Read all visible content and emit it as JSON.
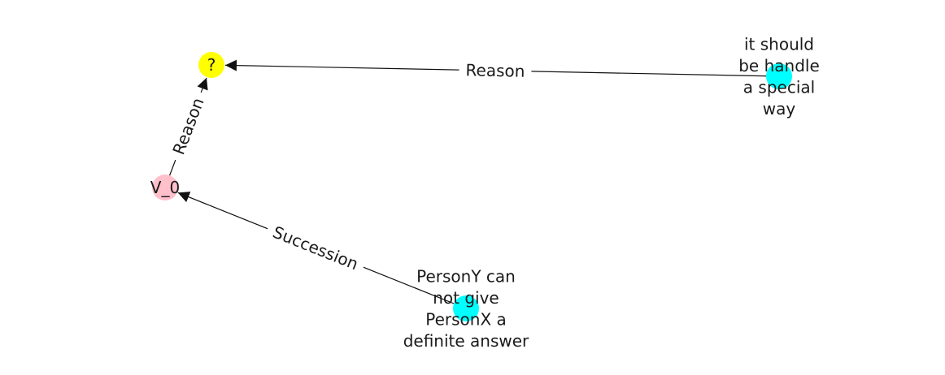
{
  "graph": {
    "nodes": [
      {
        "id": "question",
        "label": "?",
        "color": "#ffff00"
      },
      {
        "id": "v0",
        "label": "V_0",
        "color": "#ffc0cb"
      },
      {
        "id": "handle",
        "label": "it should\nbe handle\na special\nway",
        "color": "#00ffff"
      },
      {
        "id": "persony",
        "label": "PersonY can\nnot give\nPersonX a\ndefinite answer",
        "color": "#00ffff"
      }
    ],
    "edges": [
      {
        "id": "handle-to-question",
        "source": "handle",
        "target": "question",
        "label": "Reason"
      },
      {
        "id": "v0-to-question",
        "source": "v0",
        "target": "question",
        "label": "Reason"
      },
      {
        "id": "persony-to-v0",
        "source": "persony",
        "target": "v0",
        "label": "Succession"
      }
    ]
  }
}
